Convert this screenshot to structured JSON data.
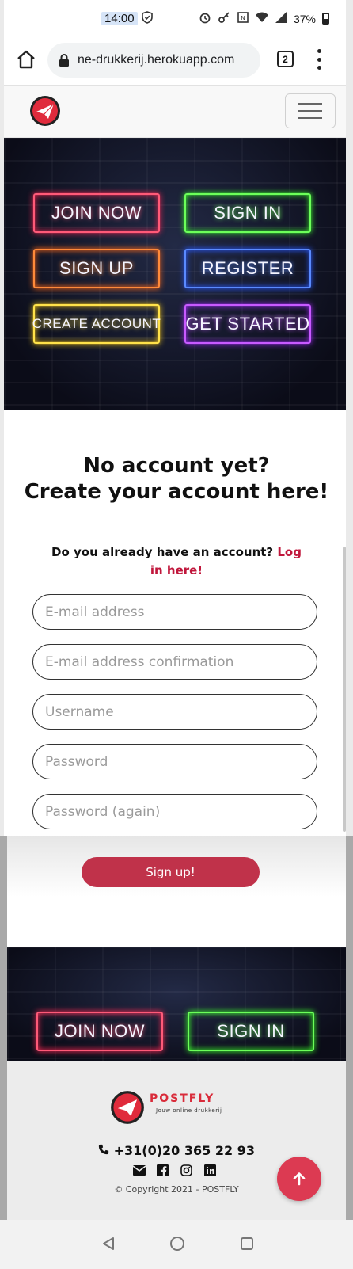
{
  "status_bar": {
    "time": "14:00",
    "battery": "37%",
    "icons": [
      "shield-icon",
      "alarm-icon",
      "key-icon",
      "nfc-icon",
      "wifi-icon",
      "signal-icon",
      "battery-icon"
    ]
  },
  "browser": {
    "url": "ne-drukkerij.herokuapp.com",
    "tab_count": "2"
  },
  "hero": {
    "buttons": [
      {
        "label": "JOIN NOW",
        "color": "#ff5a78"
      },
      {
        "label": "SIGN IN",
        "color": "#6cff5a"
      },
      {
        "label": "SIGN UP",
        "color": "#ff8a3a"
      },
      {
        "label": "REGISTER",
        "color": "#5a8aff"
      },
      {
        "label": "CREATE ACCOUNT",
        "color": "#ffe24a"
      },
      {
        "label": "GET STARTED",
        "color": "#c85aff"
      }
    ]
  },
  "form": {
    "heading_line1": "No account yet?",
    "heading_line2": "Create your account here!",
    "login_prompt": "Do you already have an account?",
    "login_link": "Log in here!",
    "email_placeholder": "E-mail address",
    "email_confirm_placeholder": "E-mail address confirmation",
    "username_placeholder": "Username",
    "password_placeholder": "Password",
    "password_again_placeholder": "Password (again)",
    "submit_label": "Sign up!"
  },
  "hero2": {
    "buttons": [
      {
        "label": "JOIN NOW"
      },
      {
        "label": "SIGN IN"
      }
    ]
  },
  "footer": {
    "brand": "POSTFLY",
    "tagline": "Jouw online drukkerij",
    "phone": "+31(0)20 365 22 93",
    "copyright": "© Copyright 2021 - POSTFLY",
    "accent_color": "#dc3a52"
  }
}
